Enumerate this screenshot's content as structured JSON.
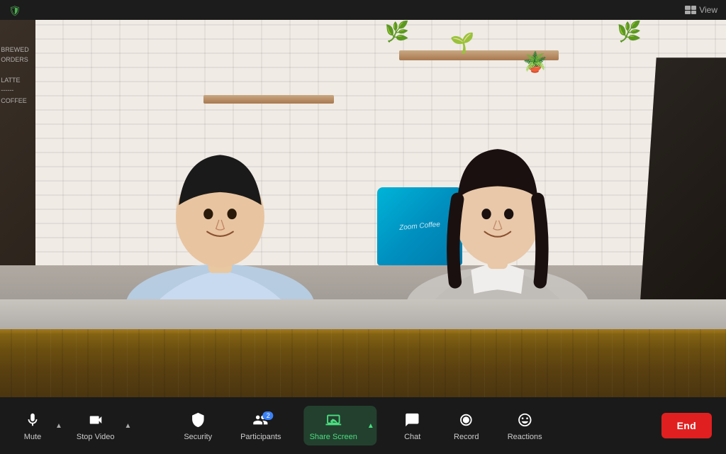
{
  "titlebar": {
    "view_label": "View",
    "shield_icon": "🛡"
  },
  "toolbar": {
    "mute_label": "Mute",
    "stop_video_label": "Stop Video",
    "security_label": "Security",
    "participants_label": "Participants",
    "participants_count": "2",
    "share_screen_label": "Share Screen",
    "chat_label": "Chat",
    "record_label": "Record",
    "reactions_label": "Reactions",
    "end_label": "End"
  },
  "scene": {
    "chalkboard_lines": [
      "BREWED",
      "ORDERS",
      "",
      "LATTE",
      "----------",
      "COFFEE"
    ],
    "coffee_machine_text": "Zoom Coffee"
  }
}
